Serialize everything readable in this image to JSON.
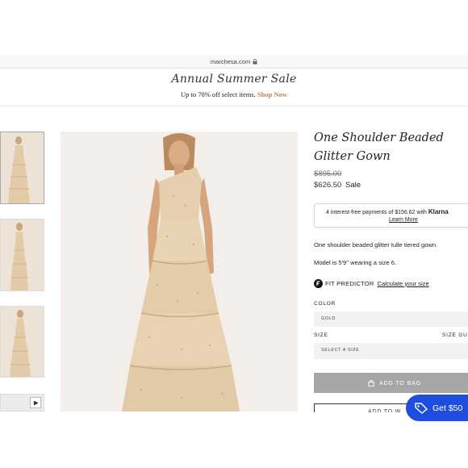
{
  "browser": {
    "url": "marchesa.com"
  },
  "promo": {
    "title": "Annual Summer Sale",
    "subtitle": "Up to 70% off select items.",
    "link": "Shop Now"
  },
  "product": {
    "title": "One Shoulder Beaded Glitter Gown",
    "price_original": "$895.00",
    "price_sale": "$626.50",
    "sale_label": "Sale",
    "description": "One shoulder beaded glitter tulle tiered gown.",
    "model_info": "Model is 5'9\" wearing a size 6."
  },
  "klarna": {
    "text": "4 interest-free payments of $156.62 with",
    "brand": "Klarna",
    "learn_more": "Learn More"
  },
  "fit_predictor": {
    "label": "FIT PREDICTOR",
    "link": "Calculate your size"
  },
  "color": {
    "label": "COLOR",
    "selected": "GOLD"
  },
  "size": {
    "label": "SIZE",
    "guide": "SIZE GU",
    "placeholder": "SELECT A SIZE"
  },
  "buttons": {
    "add_to_bag": "ADD TO BAG",
    "second_partial": "ADD TO W"
  },
  "promo_badge": {
    "text": "Get $50"
  },
  "colors": {
    "accent": "#b8865a",
    "add_button": "#a6a6a6",
    "badge": "#1f4ede",
    "dress": "#e6cfae"
  },
  "icons": [
    "lock-icon",
    "play-icon",
    "fit-predictor-icon",
    "bag-icon",
    "tag-icon"
  ]
}
